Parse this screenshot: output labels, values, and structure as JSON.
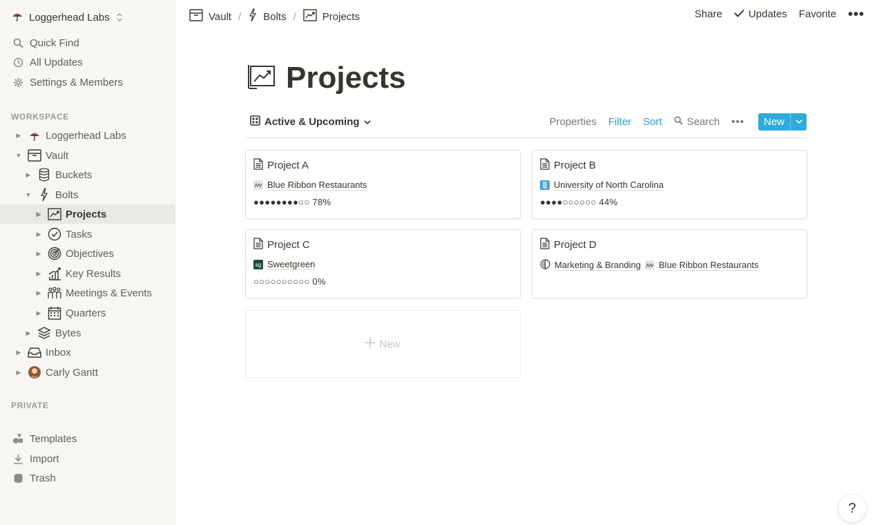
{
  "sidebar": {
    "workspace_name": "Loggerhead Labs",
    "top_items": [
      {
        "label": "Quick Find",
        "icon": "search-icon"
      },
      {
        "label": "All Updates",
        "icon": "clock-icon"
      },
      {
        "label": "Settings & Members",
        "icon": "gear-icon"
      }
    ],
    "workspace_label": "WORKSPACE",
    "tree": [
      {
        "label": "Loggerhead Labs",
        "icon": "umbrella-icon"
      },
      {
        "label": "Vault",
        "icon": "archive-icon"
      },
      {
        "label": "Buckets",
        "icon": "database-icon"
      },
      {
        "label": "Bolts",
        "icon": "bolt-icon"
      },
      {
        "label": "Projects",
        "icon": "chart-icon"
      },
      {
        "label": "Tasks",
        "icon": "check-circle-icon"
      },
      {
        "label": "Objectives",
        "icon": "target-icon"
      },
      {
        "label": "Key Results",
        "icon": "bar-chart-icon"
      },
      {
        "label": "Meetings & Events",
        "icon": "people-icon"
      },
      {
        "label": "Quarters",
        "icon": "calendar-icon"
      },
      {
        "label": "Bytes",
        "icon": "layers-icon"
      },
      {
        "label": "Inbox",
        "icon": "inbox-icon"
      },
      {
        "label": "Carly Gantt",
        "icon": "avatar-icon"
      }
    ],
    "private_label": "PRIVATE",
    "bottom_items": [
      {
        "label": "Templates",
        "icon": "shapes-icon"
      },
      {
        "label": "Import",
        "icon": "download-icon"
      },
      {
        "label": "Trash",
        "icon": "trash-icon"
      }
    ]
  },
  "topbar": {
    "breadcrumbs": [
      "Vault",
      "Bolts",
      "Projects"
    ],
    "share": "Share",
    "updates": "Updates",
    "favorite": "Favorite"
  },
  "page": {
    "title": "Projects",
    "view_name": "Active & Upcoming",
    "properties": "Properties",
    "filter": "Filter",
    "sort": "Sort",
    "search": "Search",
    "new": "New",
    "new_card": "New",
    "help": "?"
  },
  "cards": [
    {
      "title": "Project A",
      "relations": [
        {
          "label": "Blue Ribbon Restaurants",
          "icon": "ribbon-icon",
          "color": "#e8e7e4"
        }
      ],
      "progress": "●●●●●●●●○○ 78%"
    },
    {
      "title": "Project B",
      "relations": [
        {
          "label": "University of North Carolina",
          "icon": "unc-icon",
          "color": "#4a9fd5"
        }
      ],
      "progress": "●●●●○○○○○○ 44%"
    },
    {
      "title": "Project C",
      "relations": [
        {
          "label": "Sweetgreen",
          "icon": "sg-icon",
          "color": "#1f4b3a",
          "text": "sg"
        }
      ],
      "progress": "○○○○○○○○○○ 0%"
    },
    {
      "title": "Project D",
      "relations": [
        {
          "label": "Marketing & Branding",
          "icon": "half-circle-icon",
          "color": "#ffffff"
        },
        {
          "label": "Blue Ribbon Restaurants",
          "icon": "ribbon-icon",
          "color": "#e8e7e4"
        }
      ],
      "progress": ""
    }
  ],
  "colors": {
    "accent": "#2eaadc",
    "link": "#2e9cd0",
    "sidebar_bg": "#f7f6f3"
  }
}
